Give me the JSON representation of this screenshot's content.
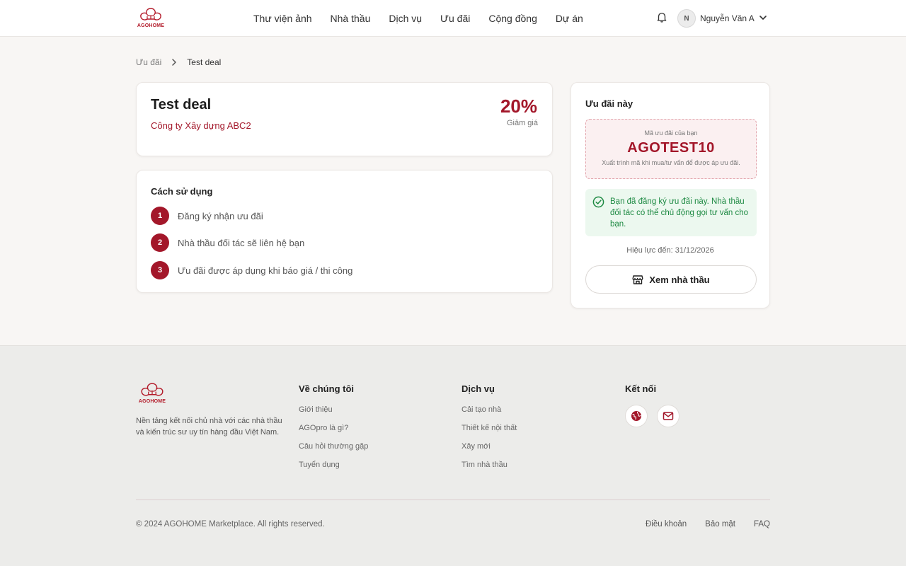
{
  "brand": {
    "name": "AGOHOME",
    "color": "#a3172a"
  },
  "nav": {
    "items": [
      {
        "label": "Thư viện ảnh"
      },
      {
        "label": "Nhà thầu"
      },
      {
        "label": "Dịch vụ"
      },
      {
        "label": "Ưu đãi"
      },
      {
        "label": "Cộng đồng"
      },
      {
        "label": "Dự án"
      }
    ]
  },
  "user": {
    "initial": "N",
    "name": "Nguyễn Văn A"
  },
  "breadcrumb": {
    "parent": "Ưu đãi",
    "current": "Test deal"
  },
  "deal": {
    "title": "Test deal",
    "company": "Công ty Xây dựng ABC2",
    "discount": "20%",
    "discount_label": "Giảm giá"
  },
  "usage": {
    "title": "Cách sử dụng",
    "steps": [
      {
        "num": "1",
        "text": "Đăng ký nhận ưu đãi"
      },
      {
        "num": "2",
        "text": "Nhà thầu đối tác sẽ liên hệ bạn"
      },
      {
        "num": "3",
        "text": "Ưu đãi được áp dụng khi báo giá / thi công"
      }
    ]
  },
  "sidebar": {
    "title": "Ưu đãi này",
    "code_label": "Mã ưu đãi của bạn",
    "code": "AGOTEST10",
    "code_hint": "Xuất trình mã khi mua/tư vấn để được áp ưu đãi.",
    "notice": "Bạn đã đăng ký ưu đãi này. Nhà thầu đối tác có thể chủ động gọi tư vấn cho bạn.",
    "validity": "Hiệu lực đến: 31/12/2026",
    "view_button": "Xem nhà thầu"
  },
  "footer": {
    "description": "Nền tảng kết nối chủ nhà với các nhà thầu và kiến trúc sư uy tín hàng đầu Việt Nam.",
    "about": {
      "title": "Về chúng tôi",
      "links": [
        "Giới thiệu",
        "AGOpro là gì?",
        "Câu hỏi thường gặp",
        "Tuyển dụng"
      ]
    },
    "services": {
      "title": "Dịch vụ",
      "links": [
        "Cải tạo nhà",
        "Thiết kế nội thất",
        "Xây mới",
        "Tìm nhà thầu"
      ]
    },
    "connect": {
      "title": "Kết nối",
      "icons": [
        "globe-icon",
        "mail-icon"
      ]
    },
    "copyright": "© 2024 AGOHOME Marketplace. All rights reserved.",
    "bottom_links": [
      "Điều khoản",
      "Bảo mật",
      "FAQ"
    ]
  }
}
